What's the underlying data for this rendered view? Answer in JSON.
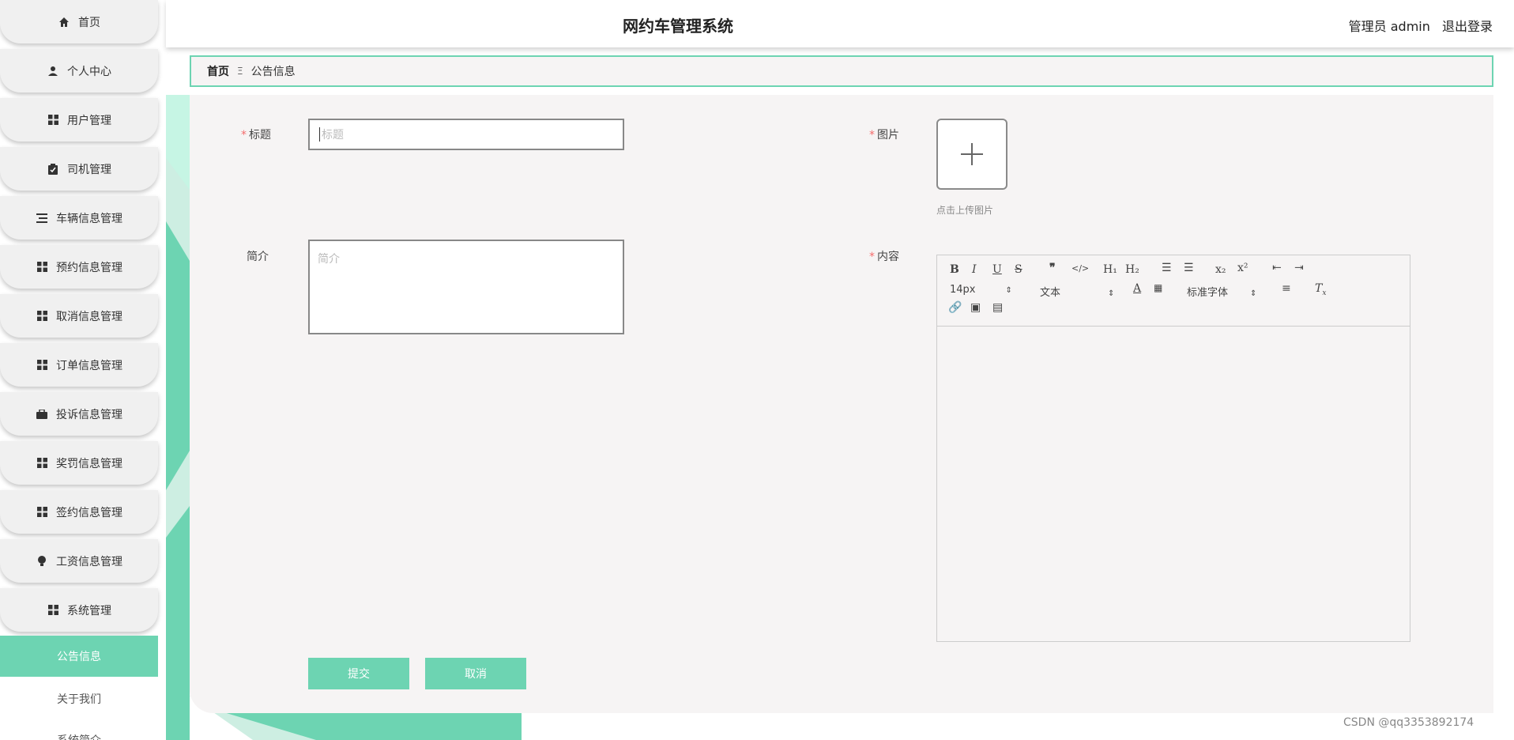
{
  "header": {
    "title": "网约车管理系统",
    "user": "管理员 admin",
    "logout": "退出登录"
  },
  "sidebar": {
    "items": [
      {
        "label": "首页",
        "icon": "home-icon"
      },
      {
        "label": "个人中心",
        "icon": "user-icon"
      },
      {
        "label": "用户管理",
        "icon": "grid-icon"
      },
      {
        "label": "司机管理",
        "icon": "clipboard-icon"
      },
      {
        "label": "车辆信息管理",
        "icon": "list-icon"
      },
      {
        "label": "预约信息管理",
        "icon": "grid-icon"
      },
      {
        "label": "取消信息管理",
        "icon": "grid-icon"
      },
      {
        "label": "订单信息管理",
        "icon": "grid-icon"
      },
      {
        "label": "投诉信息管理",
        "icon": "briefcase-icon"
      },
      {
        "label": "奖罚信息管理",
        "icon": "grid-icon"
      },
      {
        "label": "签约信息管理",
        "icon": "grid-icon"
      },
      {
        "label": "工资信息管理",
        "icon": "bulb-icon"
      },
      {
        "label": "系统管理",
        "icon": "grid-icon"
      }
    ],
    "sub_items": [
      {
        "label": "公告信息",
        "active": true
      },
      {
        "label": "关于我们",
        "active": false
      },
      {
        "label": "系统简介",
        "active": false
      }
    ]
  },
  "breadcrumb": {
    "home": "首页",
    "separator": "Ξ",
    "current": "公告信息"
  },
  "form": {
    "title_label": "标题",
    "title_placeholder": "标题",
    "image_label": "图片",
    "upload_hint": "点击上传图片",
    "intro_label": "简介",
    "intro_placeholder": "简介",
    "content_label": "内容",
    "submit": "提交",
    "cancel": "取消"
  },
  "editor": {
    "font_size": "14px",
    "paragraph": "文本",
    "font_family": "标准字体"
  },
  "watermark": "CSDN @qq3353892174",
  "colors": {
    "accent": "#6dd4b2",
    "panel": "#f6f4f4",
    "required": "#f56c6c"
  }
}
